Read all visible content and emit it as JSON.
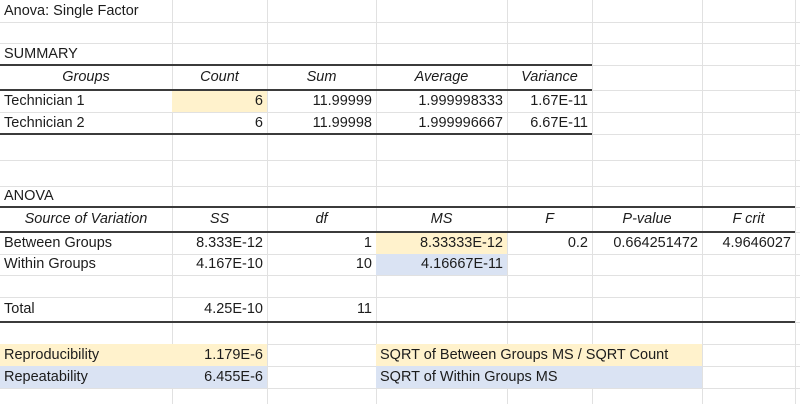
{
  "spreadsheet": {
    "colors": {
      "highlight_yellow": "#FFF2CC",
      "highlight_blue": "#DAE3F3",
      "border_dark": "#3B3B3B",
      "gridline": "#E1E1E1",
      "text": "#1C1C1C"
    },
    "cells": [
      {
        "row": 1,
        "col": 1,
        "name": "title",
        "text": "Anova: Single Factor",
        "align": "left"
      },
      {
        "row": 3,
        "col": 1,
        "name": "summary-label",
        "text": "SUMMARY",
        "align": "left"
      },
      {
        "row": 4,
        "col": 1,
        "name": "summary-header-groups",
        "text": "Groups",
        "align": "center",
        "italic": true
      },
      {
        "row": 4,
        "col": 2,
        "name": "summary-header-count",
        "text": "Count",
        "align": "center",
        "italic": true
      },
      {
        "row": 4,
        "col": 3,
        "name": "summary-header-sum",
        "text": "Sum",
        "align": "center",
        "italic": true
      },
      {
        "row": 4,
        "col": 4,
        "name": "summary-header-average",
        "text": "Average",
        "align": "center",
        "italic": true
      },
      {
        "row": 4,
        "col": 5,
        "name": "summary-header-variance",
        "text": "Variance",
        "align": "center",
        "italic": true
      },
      {
        "row": 5,
        "col": 1,
        "name": "technician1-label",
        "text": "Technician 1",
        "align": "left"
      },
      {
        "row": 5,
        "col": 2,
        "name": "technician1-count",
        "text": "6",
        "align": "right",
        "fill": "yellow"
      },
      {
        "row": 5,
        "col": 3,
        "name": "technician1-sum",
        "text": "11.99999",
        "align": "right"
      },
      {
        "row": 5,
        "col": 4,
        "name": "technician1-average",
        "text": "1.999998333",
        "align": "right"
      },
      {
        "row": 5,
        "col": 5,
        "name": "technician1-variance",
        "text": "1.67E-11",
        "align": "right"
      },
      {
        "row": 6,
        "col": 1,
        "name": "technician2-label",
        "text": "Technician 2",
        "align": "left"
      },
      {
        "row": 6,
        "col": 2,
        "name": "technician2-count",
        "text": "6",
        "align": "right"
      },
      {
        "row": 6,
        "col": 3,
        "name": "technician2-sum",
        "text": "11.99998",
        "align": "right"
      },
      {
        "row": 6,
        "col": 4,
        "name": "technician2-average",
        "text": "1.999996667",
        "align": "right"
      },
      {
        "row": 6,
        "col": 5,
        "name": "technician2-variance",
        "text": "6.67E-11",
        "align": "right"
      },
      {
        "row": 9,
        "col": 1,
        "name": "anova-label",
        "text": "ANOVA",
        "align": "left"
      },
      {
        "row": 10,
        "col": 1,
        "name": "anova-header-source",
        "text": "Source of Variation",
        "align": "center",
        "italic": true
      },
      {
        "row": 10,
        "col": 2,
        "name": "anova-header-ss",
        "text": "SS",
        "align": "center",
        "italic": true
      },
      {
        "row": 10,
        "col": 3,
        "name": "anova-header-df",
        "text": "df",
        "align": "center",
        "italic": true
      },
      {
        "row": 10,
        "col": 4,
        "name": "anova-header-ms",
        "text": "MS",
        "align": "center",
        "italic": true
      },
      {
        "row": 10,
        "col": 5,
        "name": "anova-header-f",
        "text": "F",
        "align": "center",
        "italic": true
      },
      {
        "row": 10,
        "col": 6,
        "name": "anova-header-pvalue",
        "text": "P-value",
        "align": "center",
        "italic": true
      },
      {
        "row": 10,
        "col": 7,
        "name": "anova-header-fcrit",
        "text": "F crit",
        "align": "center",
        "italic": true
      },
      {
        "row": 11,
        "col": 1,
        "name": "between-groups-label",
        "text": "Between Groups",
        "align": "left"
      },
      {
        "row": 11,
        "col": 2,
        "name": "between-groups-ss",
        "text": "8.333E-12",
        "align": "right"
      },
      {
        "row": 11,
        "col": 3,
        "name": "between-groups-df",
        "text": "1",
        "align": "right"
      },
      {
        "row": 11,
        "col": 4,
        "name": "between-groups-ms",
        "text": "8.33333E-12",
        "align": "right",
        "fill": "yellow"
      },
      {
        "row": 11,
        "col": 5,
        "name": "between-groups-f",
        "text": "0.2",
        "align": "right"
      },
      {
        "row": 11,
        "col": 6,
        "name": "between-groups-pvalue",
        "text": "0.664251472",
        "align": "right"
      },
      {
        "row": 11,
        "col": 7,
        "name": "between-groups-fcrit",
        "text": "4.9646027",
        "align": "right"
      },
      {
        "row": 12,
        "col": 1,
        "name": "within-groups-label",
        "text": "Within Groups",
        "align": "left"
      },
      {
        "row": 12,
        "col": 2,
        "name": "within-groups-ss",
        "text": "4.167E-10",
        "align": "right"
      },
      {
        "row": 12,
        "col": 3,
        "name": "within-groups-df",
        "text": "10",
        "align": "right"
      },
      {
        "row": 12,
        "col": 4,
        "name": "within-groups-ms",
        "text": "4.16667E-11",
        "align": "right",
        "fill": "blue"
      },
      {
        "row": 14,
        "col": 1,
        "name": "total-label",
        "text": "Total",
        "align": "left"
      },
      {
        "row": 14,
        "col": 2,
        "name": "total-ss",
        "text": "4.25E-10",
        "align": "right"
      },
      {
        "row": 14,
        "col": 3,
        "name": "total-df",
        "text": "11",
        "align": "right"
      },
      {
        "row": 16,
        "col": 1,
        "name": "reproducibility-label",
        "text": "Reproducibility",
        "align": "left",
        "fill": "yellow"
      },
      {
        "row": 16,
        "col": 2,
        "name": "reproducibility-value",
        "text": "1.179E-6",
        "align": "right",
        "fill": "yellow"
      },
      {
        "row": 16,
        "col": 4,
        "span": 3,
        "name": "reproducibility-note",
        "text": "SQRT of Between Groups MS / SQRT Count",
        "align": "left",
        "fill": "yellow"
      },
      {
        "row": 17,
        "col": 1,
        "name": "repeatability-label",
        "text": "Repeatability",
        "align": "left",
        "fill": "blue"
      },
      {
        "row": 17,
        "col": 2,
        "name": "repeatability-value",
        "text": "6.455E-6",
        "align": "right",
        "fill": "blue"
      },
      {
        "row": 17,
        "col": 4,
        "span": 3,
        "name": "repeatability-note",
        "text": "SQRT of Within Groups MS",
        "align": "left",
        "fill": "blue"
      }
    ]
  }
}
